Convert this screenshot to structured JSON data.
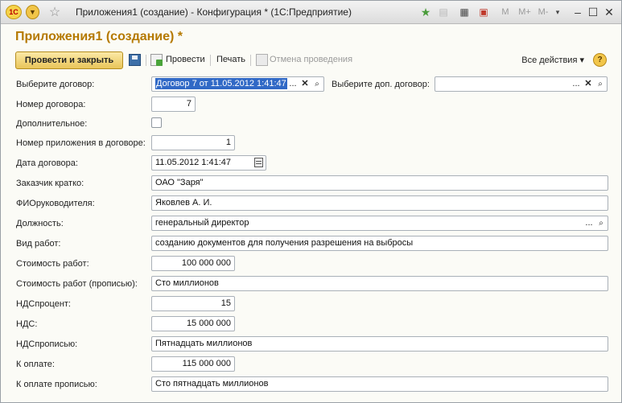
{
  "window": {
    "title": "Приложения1 (создание) - Конфигурация * (1С:Предприятие)",
    "logo": "1С",
    "right_controls": [
      "M",
      "M+",
      "M-"
    ]
  },
  "form": {
    "title": "Приложения1 (создание) *"
  },
  "toolbar": {
    "post_and_close": "Провести и закрыть",
    "post": "Провести",
    "print": "Печать",
    "unpost": "Отмена проведения",
    "all_actions": "Все действия ▾",
    "help": "?"
  },
  "fields": {
    "contract": {
      "label": "Выберите договор:",
      "value": "Договор 7 от 11.05.2012 1:41:47"
    },
    "extra_contract": {
      "label": "Выберите доп. договор:",
      "value": ""
    },
    "contract_number": {
      "label": "Номер договора:",
      "value": "7"
    },
    "additional": {
      "label": "Дополнительное:",
      "checked": false
    },
    "appendix_number": {
      "label": "Номер приложения в договоре:",
      "value": "1"
    },
    "contract_date": {
      "label": "Дата договора:",
      "value": "11.05.2012  1:41:47"
    },
    "customer_short": {
      "label": "Заказчик кратко:",
      "value": "ОАО \"Заря\""
    },
    "director_name": {
      "label": "ФИОруководителя:",
      "value": "Яковлев А. И."
    },
    "position": {
      "label": "Должность:",
      "value": "генеральный директор"
    },
    "work_type": {
      "label": "Вид работ:",
      "value": "созданию документов для получения разрешения на выбросы"
    },
    "work_cost": {
      "label": "Стоимость работ:",
      "value": "100 000 000"
    },
    "work_cost_words": {
      "label": "Стоимость работ (прописью):",
      "value": "Сто миллионов"
    },
    "vat_percent": {
      "label": "НДСпроцент:",
      "value": "15"
    },
    "vat": {
      "label": "НДС:",
      "value": "15 000 000"
    },
    "vat_words": {
      "label": "НДСпрописью:",
      "value": "Пятнадцать миллионов"
    },
    "to_pay": {
      "label": "К оплате:",
      "value": "115 000 000"
    },
    "to_pay_words": {
      "label": "К оплате прописью:",
      "value": "Сто пятнадцать миллионов"
    }
  },
  "field_buttons": {
    "select": "...",
    "clear": "✕",
    "search": "🔍"
  }
}
